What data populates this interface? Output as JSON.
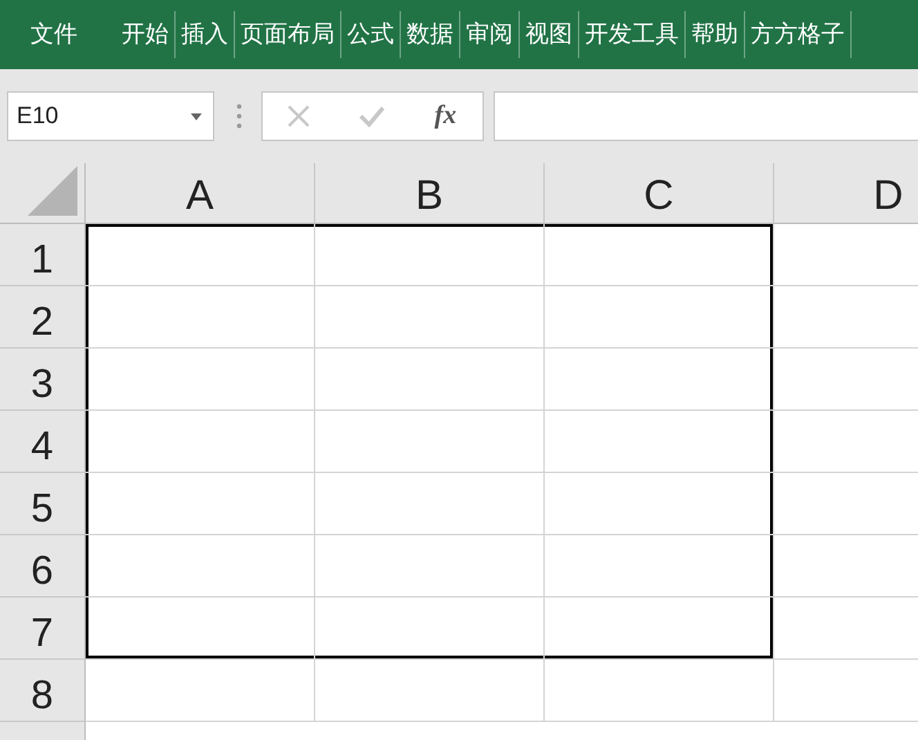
{
  "ribbon": {
    "tabs": [
      {
        "label": "文件",
        "kind": "file"
      },
      {
        "label": "开始",
        "kind": "tab"
      },
      {
        "label": "插入",
        "kind": "tab"
      },
      {
        "label": "页面布局",
        "kind": "tab"
      },
      {
        "label": "公式",
        "kind": "tab"
      },
      {
        "label": "数据",
        "kind": "tab"
      },
      {
        "label": "审阅",
        "kind": "tab"
      },
      {
        "label": "视图",
        "kind": "tab"
      },
      {
        "label": "开发工具",
        "kind": "tab"
      },
      {
        "label": "帮助",
        "kind": "tab"
      },
      {
        "label": "方方格子",
        "kind": "tab"
      }
    ]
  },
  "formula_bar": {
    "name_box": "E10",
    "function_button": "fx"
  },
  "sheet": {
    "columns": [
      {
        "label": "A",
        "outlined": true
      },
      {
        "label": "B",
        "outlined": true
      },
      {
        "label": "C",
        "outlined": true
      },
      {
        "label": "D",
        "outlined": false
      }
    ],
    "rows": [
      {
        "label": "1",
        "outlined": true
      },
      {
        "label": "2",
        "outlined": true
      },
      {
        "label": "3",
        "outlined": true
      },
      {
        "label": "4",
        "outlined": true
      },
      {
        "label": "5",
        "outlined": true
      },
      {
        "label": "6",
        "outlined": true
      },
      {
        "label": "7",
        "outlined": true
      },
      {
        "label": "8",
        "outlined": false
      }
    ]
  }
}
